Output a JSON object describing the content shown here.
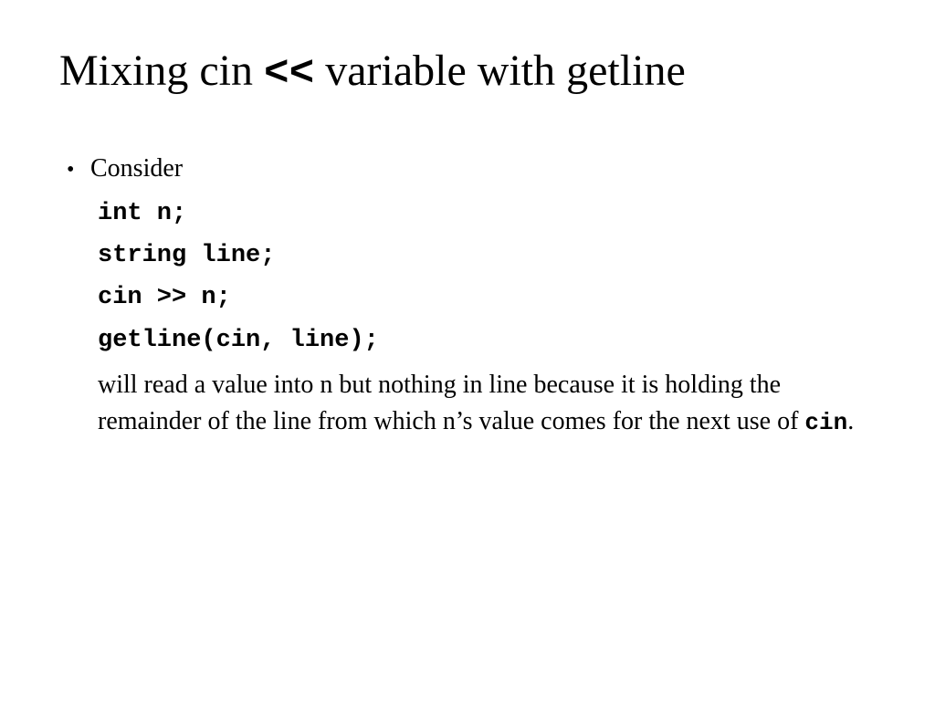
{
  "title": {
    "pre": "Mixing cin ",
    "op": "<<",
    "post": " variable with getline"
  },
  "bullet_label": "Consider",
  "code": {
    "l1": "int n;",
    "l2": "string line;",
    "l3": "cin >> n;",
    "l4": "getline(cin, line);"
  },
  "explanation": {
    "part1": "will read a value into n but nothing in line because it is holding the remainder of the line  from  which n’s value comes for the next use of ",
    "code_word": "cin",
    "part2": "."
  }
}
